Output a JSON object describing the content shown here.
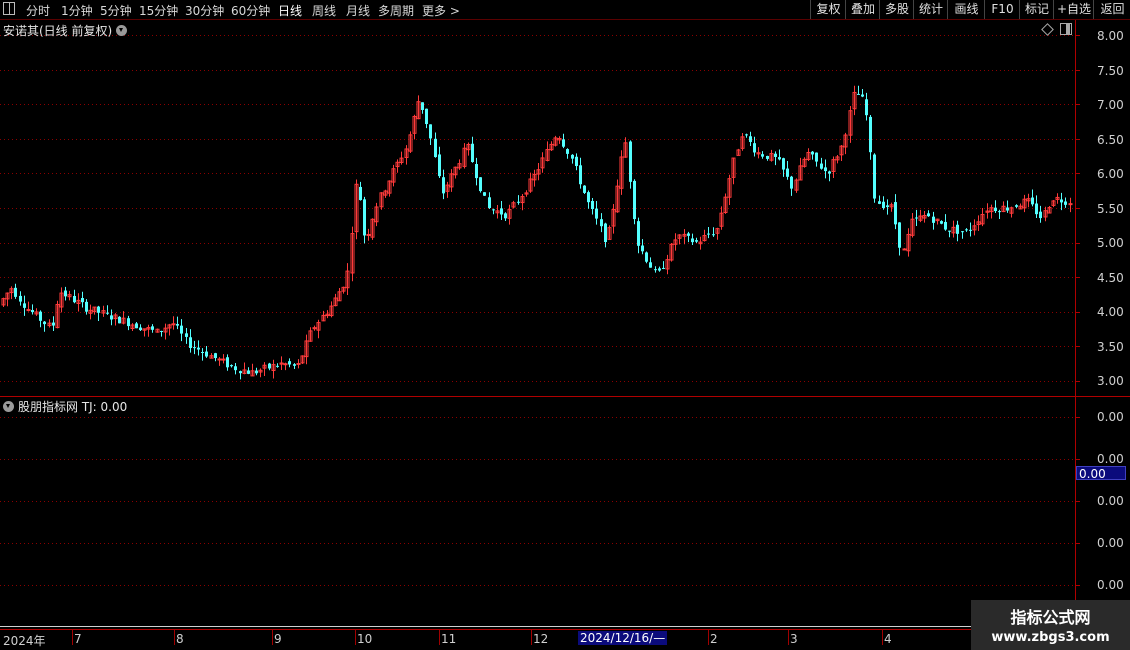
{
  "toolbar": {
    "periods": [
      "分时",
      "1分钟",
      "5分钟",
      "15分钟",
      "30分钟",
      "60分钟",
      "日线",
      "周线",
      "月线",
      "多周期",
      "更多 >"
    ],
    "active_period": "日线",
    "buttons": [
      "复权",
      "叠加",
      "多股",
      "统计",
      "画线",
      "F10",
      "标记",
      "+自选",
      "返回"
    ]
  },
  "main_chart": {
    "title": "安诺其(日线 前复权)",
    "y_ticks": [
      "8.00",
      "7.50",
      "7.00",
      "6.50",
      "6.00",
      "5.50",
      "5.00",
      "4.50",
      "4.00",
      "3.50",
      "3.00"
    ],
    "colors": {
      "up": "#ff3b3b",
      "down": "#54ffff",
      "grid": "#8b0000",
      "border": "#b00000"
    }
  },
  "sub_chart": {
    "title": "股朋指标网  TJ: 0.00",
    "y_ticks": [
      "0.00",
      "0.00",
      "0.00",
      "0.00",
      "0.00"
    ],
    "current_value": "0.00"
  },
  "date_axis": {
    "labels": [
      "2024年",
      "7",
      "8",
      "9",
      "10",
      "11",
      "12",
      "2",
      "3",
      "4"
    ],
    "crosshair_date": "2024/12/16/—"
  },
  "watermark": {
    "line1": "指标公式网",
    "line2": "www.zbgs3.com"
  },
  "chart_data": {
    "type": "candlestick",
    "title": "安诺其(日线 前复权)",
    "ylim": [
      3.0,
      8.0
    ],
    "note_values": "approximate closes, one point per visible daily session group",
    "x": [
      "2024-06",
      "2024-07",
      "2024-08",
      "2024-09",
      "2024-10",
      "2024-11",
      "2024-12",
      "2025-01",
      "2025-02",
      "2025-03",
      "2025-04"
    ],
    "series": [
      {
        "name": "close",
        "values": [
          4.2,
          4.0,
          3.6,
          3.2,
          5.0,
          6.8,
          5.6,
          4.9,
          6.2,
          6.6,
          5.4
        ]
      }
    ]
  }
}
